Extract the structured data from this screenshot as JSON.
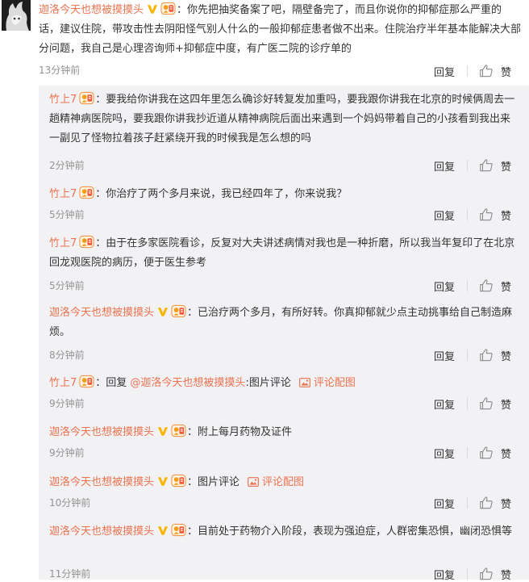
{
  "main_comment": {
    "username": "迦洛今天也想被摸摸头",
    "text": "：你先把抽奖备案了吧，隔壁备完了，而且你说你的抑郁症那么严重的话，建议住院，带攻击性去阴阳怪气别人什么的一般抑郁症患者做不出来。住院治疗半年基本能解决大部分问题，我自己是心理咨询师+抑郁症中度，有广医二院的诊疗单的",
    "time": "13分钟前",
    "reply_label": "回复",
    "like_label": "赞"
  },
  "replies": [
    {
      "username": "竹上7",
      "text": "：要我给你讲我在这四年里怎么确诊好转复发加重吗，要我跟你讲我在北京的时候俩周去一趟精神病医院吗，要我跟你讲我抄近道从精神病院后面出来遇到一个妈妈带着自己的小孩看到我出来一副见了怪物拉着孩子赶紧绕开我的时候我是怎么想的吗",
      "time": "2分钟前",
      "reply_label": "回复",
      "like_label": "赞"
    },
    {
      "username": "竹上7",
      "text": "：你治疗了两个多月来说，我已经四年了，你来说我？",
      "time": "5分钟前",
      "reply_label": "回复",
      "like_label": "赞"
    },
    {
      "username": "竹上7",
      "text": "：由于在多家医院看诊，反复对大夫讲述病情对我也是一种折磨，所以我当年复印了在北京回龙观医院的病历，便于医生参考",
      "time": "5分钟前",
      "reply_label": "回复",
      "like_label": "赞"
    },
    {
      "username": "迦洛今天也想被摸摸头",
      "text": "：已治疗两个多月，有所好转。你真抑郁就少点主动挑事给自己制造麻烦。",
      "time": "8分钟前",
      "reply_label": "回复",
      "like_label": "赞"
    },
    {
      "username": "竹上7",
      "prefix": "：回复 ",
      "mention": "@迦洛今天也想被摸摸头",
      "suffix": ":图片评论",
      "pic_link": "评论配图",
      "time": "9分钟前",
      "reply_label": "回复",
      "like_label": "赞"
    },
    {
      "username": "迦洛今天也想被摸摸头",
      "text": "：附上每月药物及证件",
      "time": "9分钟前",
      "reply_label": "回复",
      "like_label": "赞"
    },
    {
      "username": "迦洛今天也想被摸摸头",
      "prefix": "：图片评论",
      "pic_link": "评论配图",
      "time": "10分钟前",
      "reply_label": "回复",
      "like_label": "赞"
    },
    {
      "username": "迦洛今天也想被摸摸头",
      "text": "：目前处于药物介入阶段，表现为强迫症，人群密集恐惧，幽闭恐惧等",
      "time": "11分钟前",
      "reply_label": "回复",
      "like_label": "赞"
    }
  ],
  "colors": {
    "username": "#eb7350",
    "meta": "#939393",
    "reply_bg": "#f2f2f5",
    "vip": "#f7b500"
  }
}
